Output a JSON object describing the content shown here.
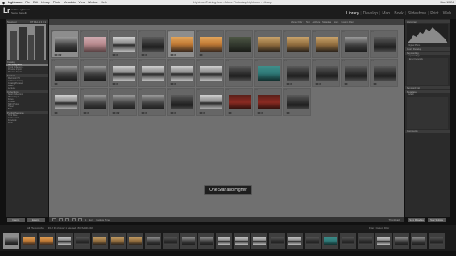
{
  "menubar": {
    "apple": "",
    "items": [
      "Lightroom",
      "File",
      "Edit",
      "Library",
      "Photo",
      "Metadata",
      "View",
      "Window",
      "Help"
    ],
    "window_title": "LightroomTraining.lrcat - Adobe Photoshop Lightroom - Library",
    "clock": "Mon 10:24"
  },
  "identity": {
    "logo": "Lr",
    "line1": "Adobe Lightroom",
    "line2": "Serge Ramelli"
  },
  "modules": {
    "items": [
      "Library",
      "Develop",
      "Map",
      "Book",
      "Slideshow",
      "Print",
      "Web"
    ],
    "active": "Library",
    "separator": "|"
  },
  "left_panel": {
    "navigator": "Navigator",
    "navigator_modes": "FIT  FILL  1:1  3:1",
    "catalog": "Catalog",
    "catalog_items": [
      "All Photographs",
      "Quick Collection +",
      "Previous Import",
      "Previous Export"
    ],
    "folders": "Folders",
    "folder_rows": [
      "Macintosh HD",
      "Lightroom Library",
      "Catalog Previews",
      "Walks",
      "Lectures"
    ],
    "collections": "Collections",
    "collection_rows": [
      "Smart Collections",
      "Photoshop C...",
      "Faces",
      "Portraits",
      "Night Photos",
      "Travel",
      "Best"
    ],
    "publish_services": "Publish Services",
    "publish_rows": [
      "Hard Drive",
      "Adobe Stock",
      "Facebook",
      "Flickr"
    ],
    "import_button": "Import...",
    "export_button": "Export..."
  },
  "right_panel": {
    "histogram": "Histogram",
    "histogram_info": "Original Photo",
    "quick_develop": "Quick Develop",
    "keywording": "Keywording",
    "keyword_tags": "Keyword Tags",
    "keyword_set": "Enter Keywords",
    "keyword_list": "Keyword List",
    "metadata": "Metadata",
    "metadata_preset": "Default",
    "comments": "Comments",
    "sync_metadata": "Sync Metadata",
    "sync_settings": "Sync Settings"
  },
  "filterbar": {
    "label": "Library Filter :",
    "options": [
      "Text",
      "Attribute",
      "Metadata",
      "None"
    ],
    "custom": "Custom Filter"
  },
  "grid": {
    "cells": [
      {
        "index": "1",
        "stars": "★★★★",
        "tone": "bw-city",
        "selected": true
      },
      {
        "index": "2",
        "stars": "",
        "tone": "pinkish"
      },
      {
        "index": "3",
        "stars": "★★★",
        "tone": "bw-lake"
      },
      {
        "index": "4",
        "stars": "★★★",
        "tone": "bw-dark"
      },
      {
        "index": "5",
        "stars": "★★★",
        "tone": "sunset",
        "selected": true
      },
      {
        "index": "6",
        "stars": "★★",
        "tone": "sunset"
      },
      {
        "index": "7",
        "stars": "",
        "tone": "dark-green"
      },
      {
        "index": "8",
        "stars": "",
        "tone": "warm-sea"
      },
      {
        "index": "9",
        "stars": "",
        "tone": "warm-sea"
      },
      {
        "index": "10",
        "stars": "",
        "tone": "warm-sea"
      },
      {
        "index": "11",
        "stars": "",
        "tone": "bw-city"
      },
      {
        "index": "12",
        "stars": "",
        "tone": "bw-dark"
      },
      {
        "index": "13",
        "stars": "★★",
        "tone": "bw-city"
      },
      {
        "index": "14",
        "stars": "",
        "tone": "bw-city"
      },
      {
        "index": "15",
        "stars": "★★★",
        "tone": "bw-lake"
      },
      {
        "index": "16",
        "stars": "",
        "tone": "bw-lake"
      },
      {
        "index": "17",
        "stars": "★★★",
        "tone": "bw-lake"
      },
      {
        "index": "18",
        "stars": "",
        "tone": "bw-lake"
      },
      {
        "index": "19",
        "stars": "",
        "tone": "bw-dark"
      },
      {
        "index": "20",
        "stars": "",
        "tone": "teal-night"
      },
      {
        "index": "21",
        "stars": "★★★",
        "tone": "bw-dark"
      },
      {
        "index": "22",
        "stars": "★★★",
        "tone": "bw-dark"
      },
      {
        "index": "23",
        "stars": "★★",
        "tone": "bw-dark"
      },
      {
        "index": "24",
        "stars": "★★",
        "tone": "bw-dark"
      },
      {
        "index": "25",
        "stars": "★★",
        "tone": "bw-lake"
      },
      {
        "index": "26",
        "stars": "★★★",
        "tone": "bw-city"
      },
      {
        "index": "27",
        "stars": "★★★★",
        "tone": "bw-city"
      },
      {
        "index": "28",
        "stars": "★★★",
        "tone": "bw-city"
      },
      {
        "index": "29",
        "stars": "★★★",
        "tone": "bw-dark"
      },
      {
        "index": "30",
        "stars": "★★★",
        "tone": "bw-lake"
      },
      {
        "index": "31",
        "stars": "★★",
        "tone": "red-interior"
      },
      {
        "index": "32",
        "stars": "★★★",
        "tone": "red-interior"
      },
      {
        "index": "33",
        "stars": "★★",
        "tone": "bw-dark"
      }
    ]
  },
  "toast": "One Star and Higher",
  "toolbar": {
    "sort_label": "Sort:",
    "sort_value": "Capture Time",
    "thumbnails_label": "Thumbnails"
  },
  "filmstrip_bar": {
    "source": "All Photographs",
    "count": "33 of 33 photos / 1 selected / 8U7A2041.CR2",
    "filter_label": "Filter :",
    "filter_value": "Custom Filter"
  },
  "filmstrip": {
    "tones": [
      "bw-city",
      "sunset",
      "sunset",
      "bw-lake",
      "bw-dark",
      "warm-sea",
      "warm-sea",
      "warm-sea",
      "bw-city",
      "bw-dark",
      "bw-city",
      "bw-city",
      "bw-lake",
      "bw-lake",
      "bw-lake",
      "bw-dark",
      "bw-lake",
      "bw-dark",
      "teal-night",
      "bw-dark",
      "bw-dark",
      "bw-lake",
      "bw-city",
      "bw-city",
      "bw-dark"
    ]
  },
  "colors": {
    "center_bg": "#707070",
    "panel_bg": "#2b2b2b",
    "sunset": "#c07a35",
    "teal": "#2f7a78",
    "red": "#8a2a22",
    "pink": "#b88a8e"
  }
}
